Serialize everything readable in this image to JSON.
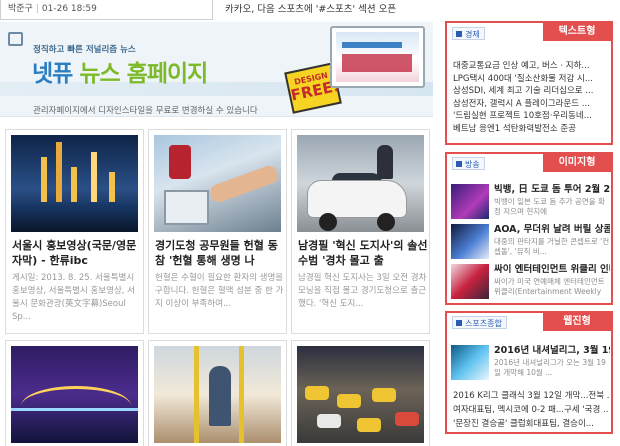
{
  "topbar": {
    "reporter": "박준구",
    "datetime": "01-26 18:59",
    "ticker": "카카오, 다음 스포츠에 '#스포츠' 섹션 오픈"
  },
  "banner": {
    "subtitle": "정직하고 빠른 저널리즘 뉴스",
    "headline_a": "넷퓨",
    "headline_b": "뉴스 홈페이지",
    "description": "관리자페이지에서 디자인스타일을 무료로 변경하실 수 있습니다",
    "badge_top": "DESIGN",
    "badge_main": "FREE!"
  },
  "articles": [
    {
      "title": "서울시 홍보영상(국문/영문자막) - 한류ibc",
      "snippet": "게시일: 2013. 8. 25. 서울특별시 홍보영상, 서울특별시 홍보영상, 서울시 문화관광(英文字幕)Seoul Sp..."
    },
    {
      "title": "경기도청 공무원들 헌혈 동참 '헌혈 통해 생명 나",
      "snippet": "헌혈은 수혈이 필요한 환자의 생명을 구합니다. 헌혈은 혈액 성분 중 한 가지 이상이 부족하여..."
    },
    {
      "title": "남경필 '혁신 도지사'의 솔선수범 '경차 몰고 출",
      "snippet": "남경필 혁신 도지사는 3일 오전 경차 모닝을 직접 몰고 경기도청으로 출근했다. '혁신 도지..."
    },
    {
      "title": "",
      "snippet": ""
    },
    {
      "title": "",
      "snippet": ""
    },
    {
      "title": "",
      "snippet": ""
    }
  ],
  "textBox": {
    "label": "텍스트형",
    "category": "경제",
    "items": [
      "대중교통요금 인상 예고, 버스 · 지하...",
      "LPG택시 400대 '질소산화물 저감 시...",
      "삼성SDI, 세계 최고 기술 리더십으로 ...",
      "삼성전자, 갤럭시 A 플레이그라운드 ...",
      "'드림실현 프로젝트 10호점·우리동네...",
      "베트남 응엔1 석탄화력발전소 준공"
    ]
  },
  "imageBox": {
    "label": "이미지형",
    "category": "방송",
    "items": [
      {
        "title": "빅뱅, 日 도쿄 돔 투어 2월 23...",
        "snippet": "빅뱅이 일본 도쿄 돔 추가 공연을 확정 지으며 현지에"
      },
      {
        "title": "AOA, 무더위 날려 버릴 상콤발...",
        "snippet": "대중의 판타지를 거닐한 콘셉트로 '컨셉돌', '뮤직 비..."
      },
      {
        "title": "싸이 엔터테인먼트 위클리 인터...",
        "snippet": "싸이가 미국 연예매체 엔터테인먼트 위클리(Entertainment Weekly"
      }
    ]
  },
  "webzineBox": {
    "label": "웹진형",
    "category": "스포츠종합",
    "feature": {
      "title": "2016년 내셔널리그, 3월 19일 ...",
      "snippet": "2016년 내셔널리그가 오는 3월 19일 개막해 10월 ..."
    },
    "items": [
      "2016 K리그 클래식 3월 12일 개막...전북 ...",
      "여자대표팀, 멕시코에 0-2 패...구세 '국경 ...",
      "'문장진 결승골' 클럽회대표팀, 결승이..."
    ]
  },
  "colors": {
    "accent": "#e34f4f",
    "brandBlue": "#2a7ec4",
    "brandGreen": "#7cba2a"
  },
  "icons": [
    "newspaper-icon",
    "category-square-icon"
  ]
}
